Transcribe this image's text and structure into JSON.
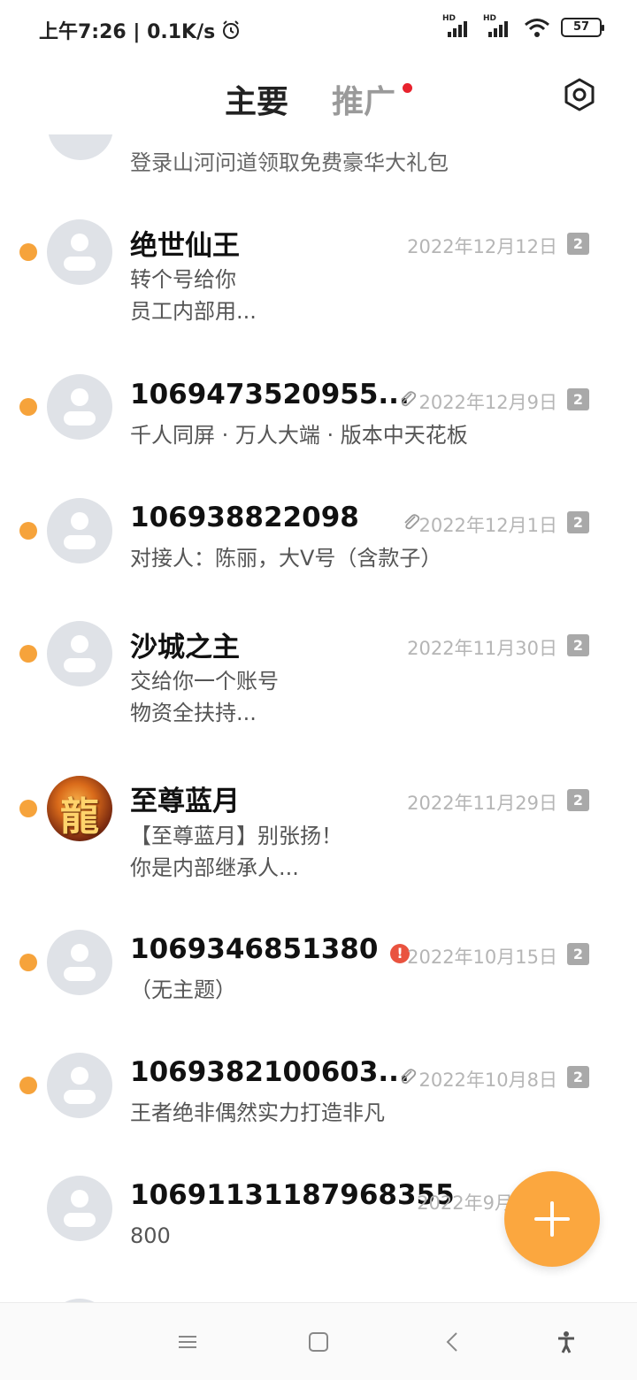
{
  "status_bar": {
    "time_speed": "上午7:26 | 0.1K/s",
    "signal_label": "HD",
    "battery": "57"
  },
  "header": {
    "tab_main": "主要",
    "tab_promo": "推广"
  },
  "partial_row": {
    "preview": "登录山河问道领取免费豪华大礼包"
  },
  "messages": [
    {
      "name": "绝世仙王",
      "date": "2022年12月12日",
      "sim": "2",
      "line1": "转个号给你",
      "line2": "员工内部用..."
    },
    {
      "name": "1069473520955...",
      "date": "2022年12月9日",
      "sim": "2",
      "line1": "千人同屏 · 万人大端 · 版本中天花板",
      "line2": ""
    },
    {
      "name": "106938822098",
      "date": "2022年12月1日",
      "sim": "2",
      "line1": "对接人：陈丽，大V号（含款子）",
      "line2": ""
    },
    {
      "name": "沙城之主",
      "date": "2022年11月30日",
      "sim": "2",
      "line1": "交给你一个账号",
      "line2": "物资全扶持..."
    },
    {
      "name": "至尊蓝月",
      "date": "2022年11月29日",
      "sim": "2",
      "line1": "【至尊蓝月】别张扬！",
      "line2": "你是内部继承人...",
      "avatar_glyph": "龍"
    },
    {
      "name": "1069346851380",
      "date": "2022年10月15日",
      "sim": "2",
      "line1": "（无主题）",
      "line2": "",
      "error_glyph": "!"
    },
    {
      "name": "1069382100603...",
      "date": "2022年10月8日",
      "sim": "2",
      "line1": "王者绝非偶然实力打造非凡",
      "line2": ""
    },
    {
      "name": "10691131187968355",
      "date": "2022年9月",
      "sim": "",
      "line1": "800",
      "line2": ""
    }
  ],
  "colors": {
    "unread_dot": "#f6a33b",
    "fab": "#fba73f",
    "promo_badge": "#e8222d",
    "error": "#e9533f"
  }
}
